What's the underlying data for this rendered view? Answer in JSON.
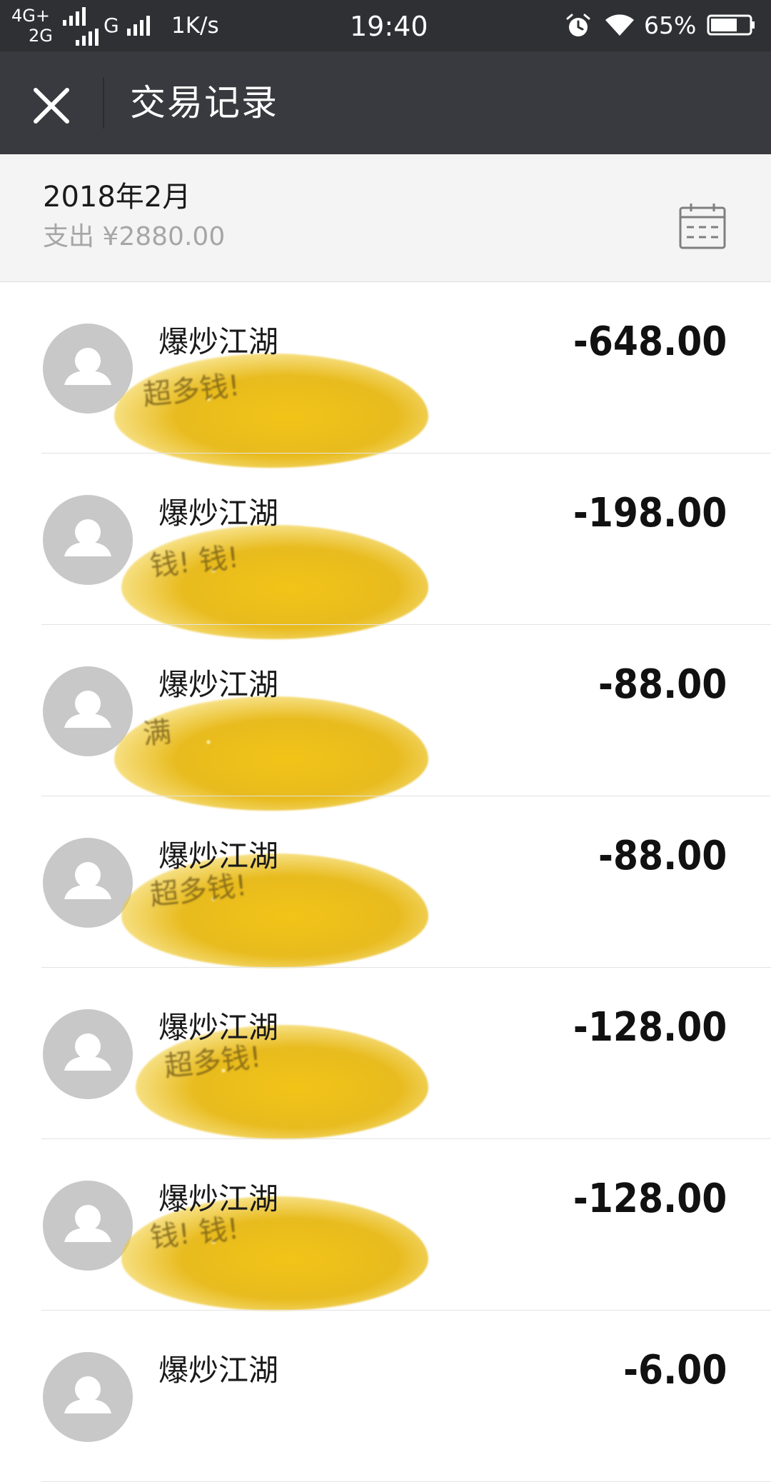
{
  "status_bar": {
    "network_top": "4G+",
    "network_bottom": "2G",
    "network_g": "G",
    "speed": "1K/s",
    "time": "19:40",
    "battery_percent": "65%",
    "icons": [
      "signal-icon",
      "alarm-icon",
      "wifi-icon",
      "battery-icon"
    ]
  },
  "title_bar": {
    "close_icon": "close-icon",
    "title": "交易记录"
  },
  "month_header": {
    "month": "2018年2月",
    "summary": "支出 ¥2880.00",
    "calendar_icon": "calendar-icon"
  },
  "transactions": [
    {
      "name": "爆炒江湖",
      "amount": "-648.00",
      "sticker": "超多钱!"
    },
    {
      "name": "爆炒江湖",
      "amount": "-198.00",
      "sticker": "钱! 钱!"
    },
    {
      "name": "爆炒江湖",
      "amount": "-88.00",
      "sticker": "满"
    },
    {
      "name": "爆炒江湖",
      "amount": "-88.00",
      "sticker": "超多钱!"
    },
    {
      "name": "爆炒江湖",
      "amount": "-128.00",
      "sticker": "超多钱!"
    },
    {
      "name": "爆炒江湖",
      "amount": "-128.00",
      "sticker": "钱! 钱!"
    },
    {
      "name": "爆炒江湖",
      "amount": "-6.00",
      "sticker": ""
    }
  ],
  "colors": {
    "status_bar_bg": "#2f3034",
    "title_bar_bg": "#393a3f",
    "header_bg": "#f4f4f4",
    "avatar_bg": "#c8c8c8",
    "sticker_gold": "#f2c418"
  }
}
